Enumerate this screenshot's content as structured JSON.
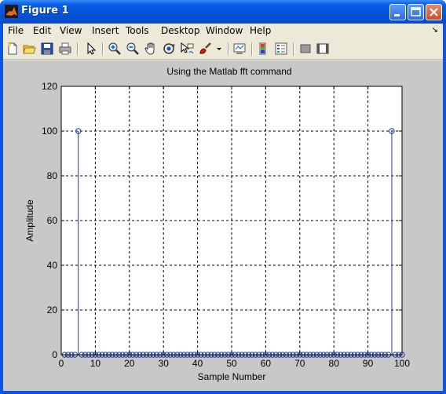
{
  "window": {
    "title": "Figure 1",
    "title_icon": "matlab-logo-icon",
    "controls": [
      "minimize-icon",
      "maximize-icon",
      "close-icon"
    ]
  },
  "menu": {
    "items": [
      {
        "label": "File"
      },
      {
        "label": "Edit"
      },
      {
        "label": "View"
      },
      {
        "label": "Insert"
      },
      {
        "label": "Tools"
      },
      {
        "label": "Desktop"
      },
      {
        "label": "Window"
      },
      {
        "label": "Help"
      }
    ],
    "corner_arrow": "↘"
  },
  "toolbar": {
    "icons": [
      "new-figure-icon",
      "open-file-icon",
      "save-icon",
      "print-icon",
      "edit-plot-arrow-icon",
      "zoom-in-icon",
      "zoom-out-icon",
      "pan-hand-icon",
      "rotate-3d-icon",
      "data-cursor-icon",
      "brush-icon",
      "dropdown-arrow-icon",
      "link-plot-icon",
      "colorbar-icon",
      "legend-icon",
      "hide-plot-tools-icon",
      "show-plot-tools-icon"
    ]
  },
  "chart_data": {
    "type": "stem",
    "title": "Using the Matlab fft command",
    "xlabel": "Sample Number",
    "ylabel": "Amplitude",
    "xlim": [
      0,
      100
    ],
    "ylim": [
      0,
      120
    ],
    "xticks": [
      0,
      10,
      20,
      30,
      40,
      50,
      60,
      70,
      80,
      90,
      100
    ],
    "yticks": [
      0,
      20,
      40,
      60,
      80,
      100,
      120
    ],
    "grid": true,
    "marker": "circle",
    "color": "#1f3fa0",
    "series": [
      {
        "x_start": 1,
        "x_end": 100,
        "baseline_value": 0,
        "peaks": [
          {
            "x": 5,
            "y": 100
          },
          {
            "x": 97,
            "y": 100
          }
        ]
      }
    ]
  }
}
